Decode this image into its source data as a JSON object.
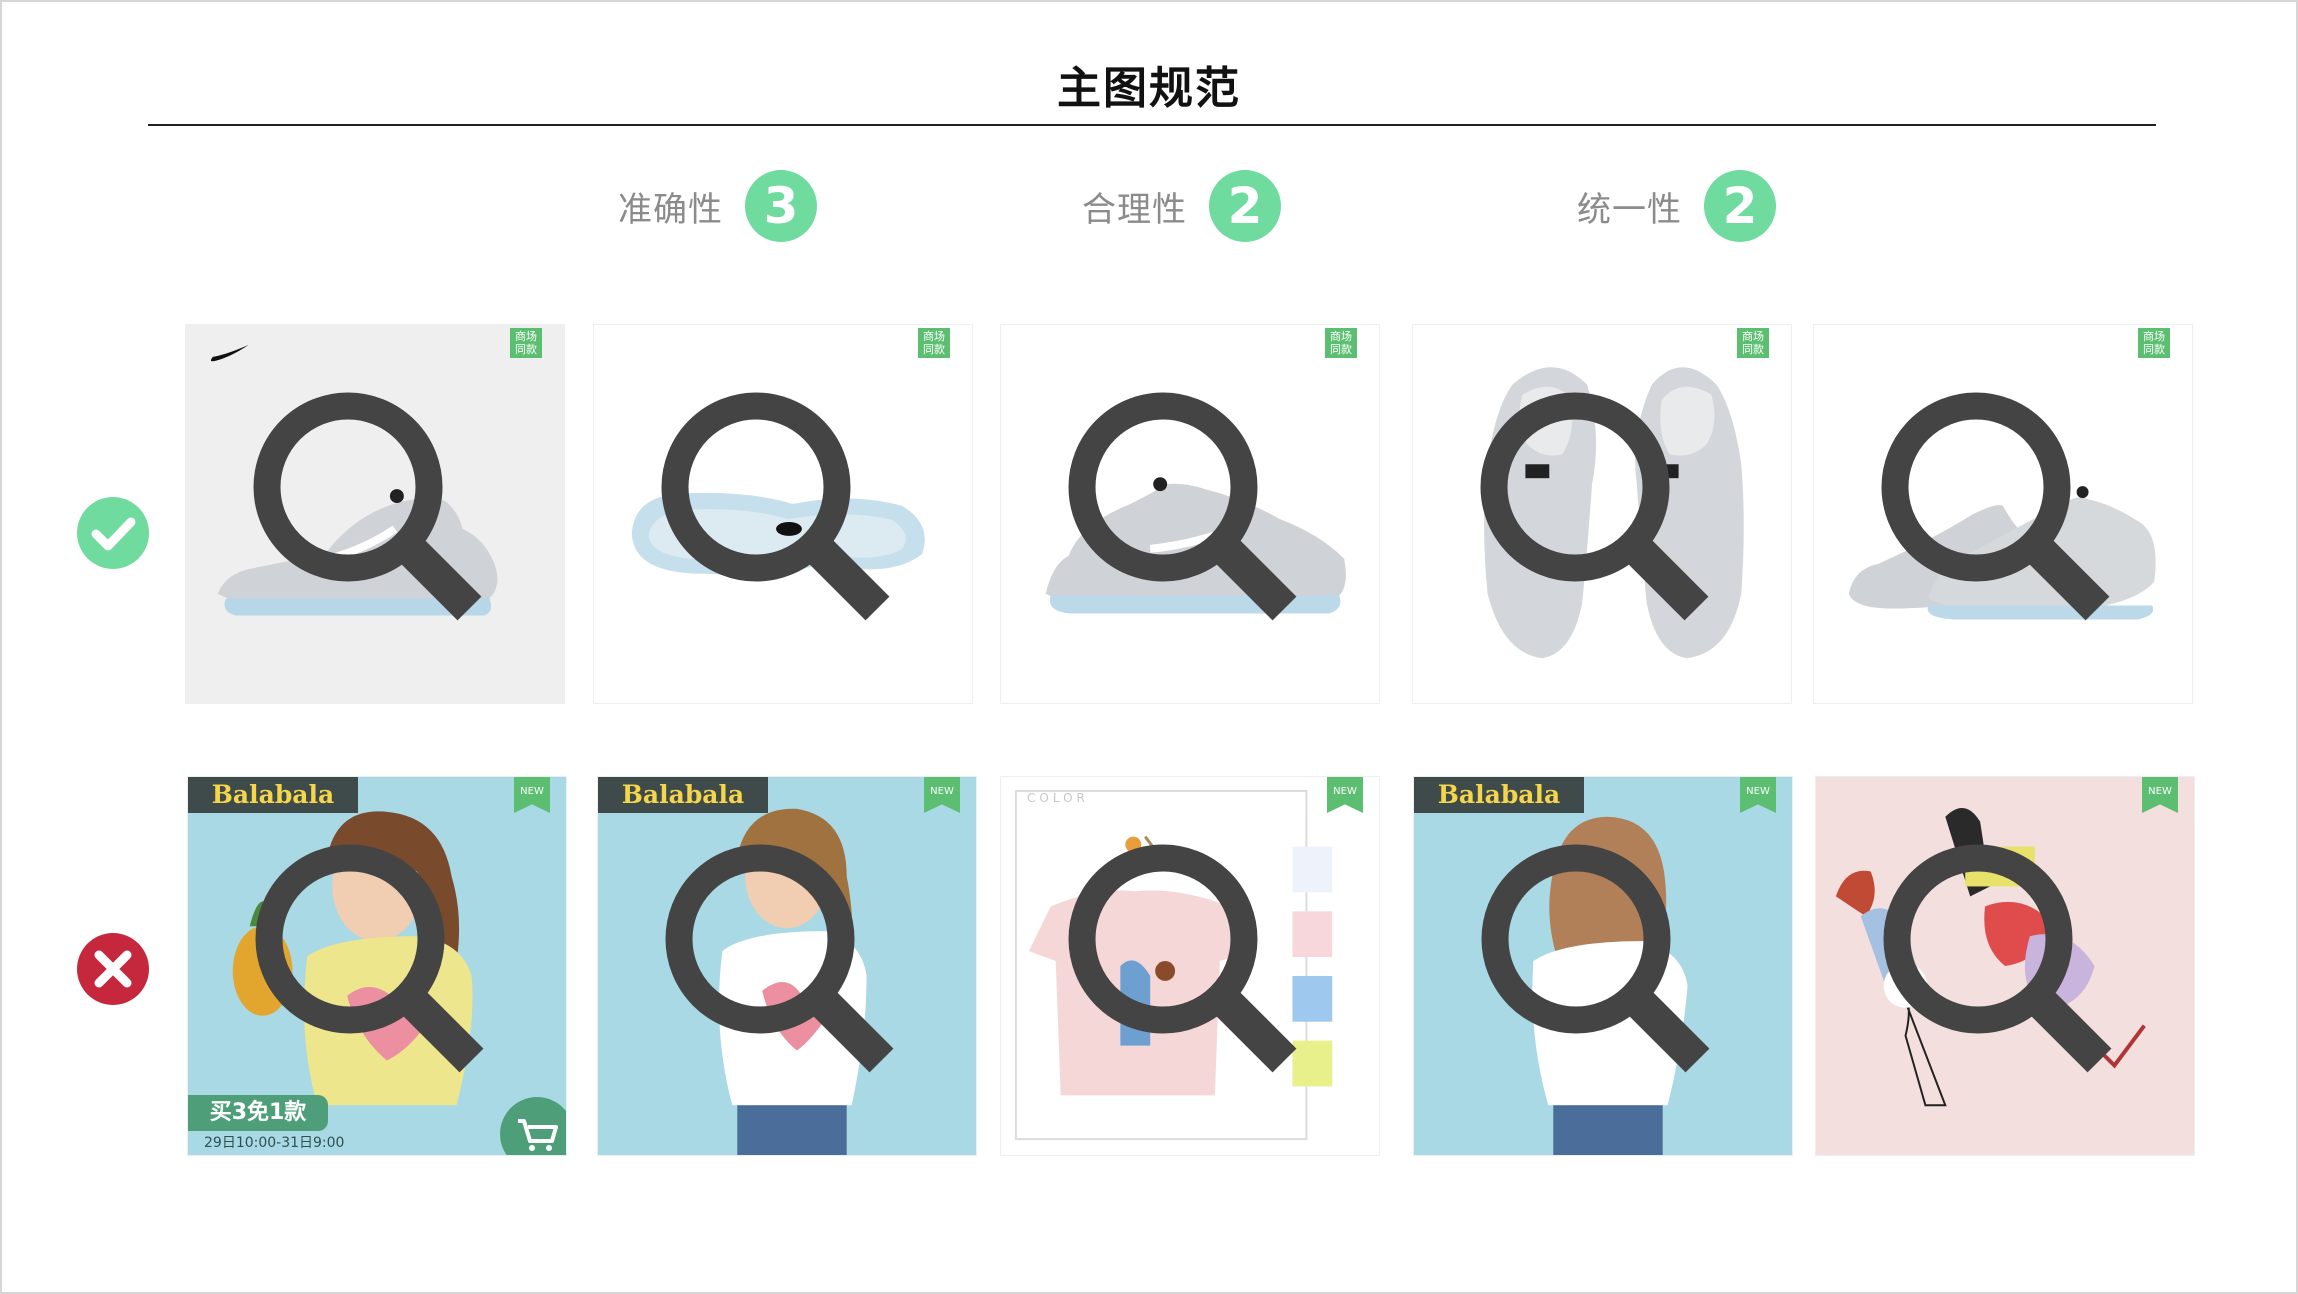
{
  "page": {
    "title": "主图规范"
  },
  "criteria": [
    {
      "label": "准确性",
      "score": "3"
    },
    {
      "label": "合理性",
      "score": "2"
    },
    {
      "label": "统一性",
      "score": "2"
    }
  ],
  "good_row": {
    "tile_badge": "商场同款",
    "status_icon": "checkmark-circle-icon",
    "status_color": "#6fdb9e"
  },
  "bad_row": {
    "brand": "Balabala",
    "tile_badge": "NEW",
    "promo_main": "买3免1款",
    "promo_sub": "29日10:00-31日9:00",
    "color_label": "COLOR",
    "status_icon": "x-circle-icon",
    "status_color": "#c5283d"
  },
  "accent_color": "#6fdb9e"
}
